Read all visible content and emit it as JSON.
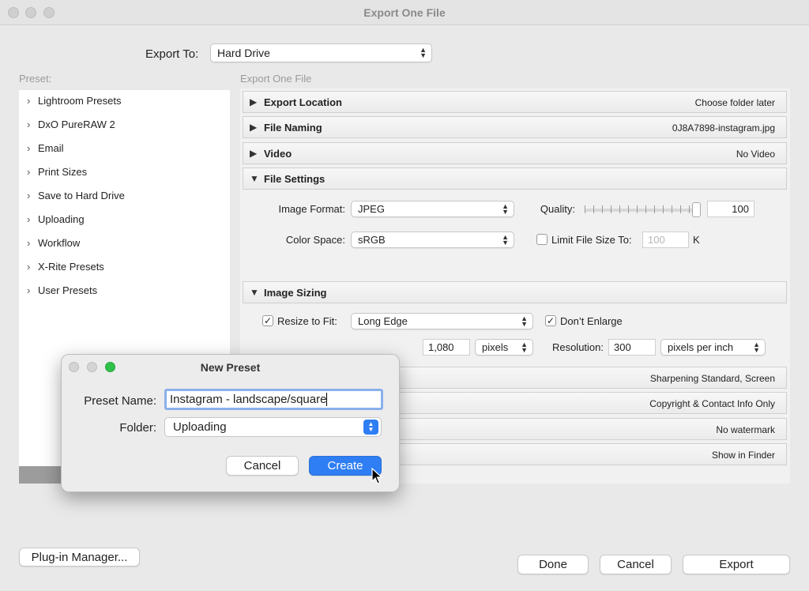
{
  "window": {
    "title": "Export One File"
  },
  "export_to": {
    "label": "Export To:",
    "value": "Hard Drive"
  },
  "preset_panel": {
    "label": "Preset:",
    "items": [
      "Lightroom Presets",
      "DxO PureRAW 2",
      "Email",
      "Print Sizes",
      "Save to Hard Drive",
      "Uploading",
      "Workflow",
      "X-Rite Presets",
      "User Presets"
    ]
  },
  "right_panel": {
    "label": "Export One File"
  },
  "sections": {
    "export_location": {
      "name": "Export Location",
      "info": "Choose folder later"
    },
    "file_naming": {
      "name": "File Naming",
      "info": "0J8A7898-instagram.jpg"
    },
    "video": {
      "name": "Video",
      "info": "No Video"
    },
    "file_settings": {
      "name": "File Settings"
    },
    "image_sizing": {
      "name": "Image Sizing"
    },
    "output_sharpening": {
      "info": "Sharpening Standard, Screen"
    },
    "metadata": {
      "info": "Copyright & Contact Info Only"
    },
    "watermarking": {
      "info": "No watermark"
    },
    "post_processing": {
      "info": "Show in Finder"
    }
  },
  "file_settings": {
    "image_format_label": "Image Format:",
    "image_format": "JPEG",
    "quality_label": "Quality:",
    "quality": "100",
    "color_space_label": "Color Space:",
    "color_space": "sRGB",
    "limit_size_label": "Limit File Size To:",
    "limit_size_value": "100",
    "limit_size_unit": "K"
  },
  "image_sizing": {
    "resize_label": "Resize to Fit:",
    "resize_mode": "Long Edge",
    "dont_enlarge_label": "Don’t Enlarge",
    "size_value": "1,080",
    "size_unit": "pixels",
    "resolution_label": "Resolution:",
    "resolution_value": "300",
    "resolution_unit": "pixels per inch"
  },
  "buttons": {
    "plugin_manager": "Plug-in Manager...",
    "done": "Done",
    "cancel": "Cancel",
    "export": "Export"
  },
  "dialog": {
    "title": "New Preset",
    "preset_name_label": "Preset Name:",
    "preset_name_value": "Instagram - landscape/square",
    "folder_label": "Folder:",
    "folder_value": "Uploading",
    "cancel": "Cancel",
    "create": "Create"
  },
  "colors": {
    "accent": "#2f7ef3",
    "focus_ring": "#8ab0ea",
    "green_light": "#2fc14a"
  }
}
